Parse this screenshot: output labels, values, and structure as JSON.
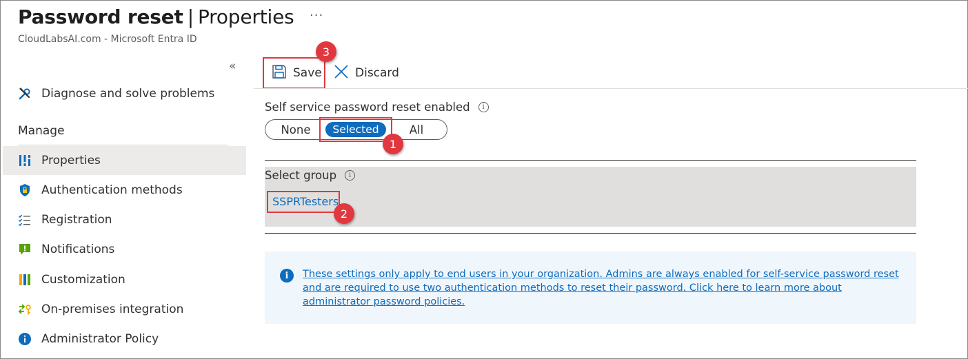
{
  "header": {
    "title_main": "Password reset",
    "title_separator": "|",
    "title_section": "Properties",
    "more_label": "···",
    "subtitle": "CloudLabsAI.com - Microsoft Entra ID"
  },
  "sidebar": {
    "collapse_label": "«",
    "top_item": {
      "label": "Diagnose and solve problems",
      "icon": "wrench-screwdriver-icon"
    },
    "section_title": "Manage",
    "items": [
      {
        "label": "Properties",
        "icon": "properties-icon",
        "active": true
      },
      {
        "label": "Authentication methods",
        "icon": "shield-lock-icon",
        "active": false
      },
      {
        "label": "Registration",
        "icon": "checklist-icon",
        "active": false
      },
      {
        "label": "Notifications",
        "icon": "notification-icon",
        "active": false
      },
      {
        "label": "Customization",
        "icon": "customization-icon",
        "active": false
      },
      {
        "label": "On-premises integration",
        "icon": "onprem-sync-icon",
        "active": false
      },
      {
        "label": "Administrator Policy",
        "icon": "info-icon",
        "active": false
      }
    ]
  },
  "toolbar": {
    "save_label": "Save",
    "discard_label": "Discard"
  },
  "form": {
    "sspr_label": "Self service password reset enabled",
    "sspr_options": [
      "None",
      "Selected",
      "All"
    ],
    "sspr_selected": "Selected",
    "group_label": "Select group",
    "group_value": "SSPRTesters"
  },
  "info_banner": {
    "text": "These settings only apply to end users in your organization. Admins are always enabled for self-service password reset and are required to use two authentication methods to reset their password. Click here to learn more about administrator password policies."
  },
  "annotations": [
    "1",
    "2",
    "3"
  ],
  "colors": {
    "accent": "#0f6cbd",
    "highlight": "#e0383e",
    "active_nav": "#edebe9",
    "group_bg": "#e1dfdd",
    "info_bg": "#eff6fc"
  }
}
